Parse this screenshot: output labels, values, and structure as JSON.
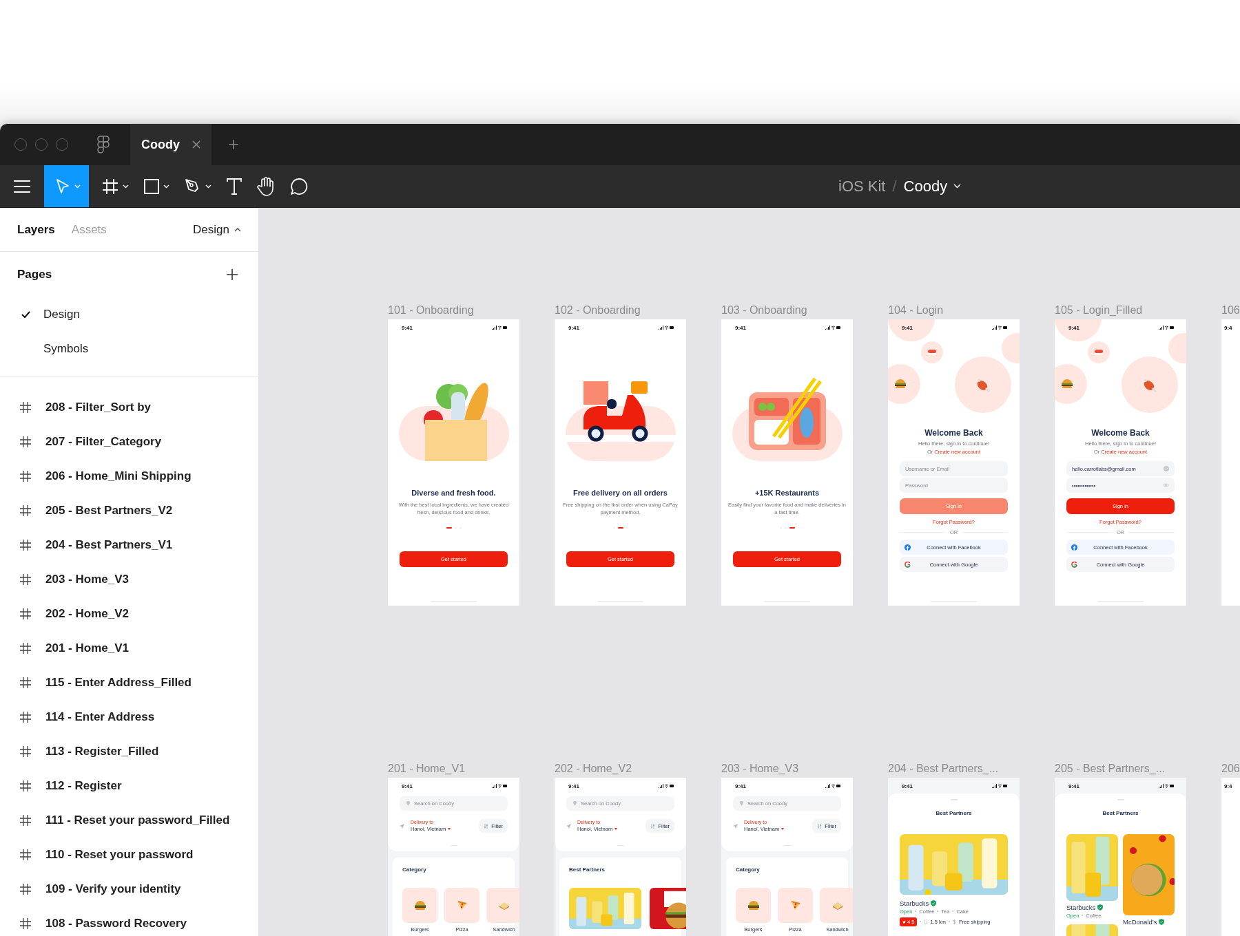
{
  "tabs": [
    {
      "label": "Coody",
      "selected": true
    }
  ],
  "toolbar": {
    "tools": [
      {
        "kind": "move",
        "selected": true
      },
      {
        "kind": "frame",
        "selected": false
      },
      {
        "kind": "shape",
        "selected": false
      },
      {
        "kind": "pen",
        "selected": false
      },
      {
        "kind": "text",
        "selected": false
      },
      {
        "kind": "hand",
        "selected": false
      },
      {
        "kind": "comment",
        "selected": false
      }
    ]
  },
  "breadcrumb": {
    "project": "iOS Kit",
    "separator": "/",
    "file": "Coody"
  },
  "sidebar": {
    "tabs": [
      {
        "label": "Layers",
        "selected": true
      },
      {
        "label": "Assets",
        "selected": false
      }
    ],
    "mode": "Design",
    "pages_title": "Pages",
    "pages": [
      {
        "label": "Design",
        "selected": true
      },
      {
        "label": "Symbols",
        "selected": false
      }
    ],
    "layers": [
      {
        "label": "208 - Filter_Sort by"
      },
      {
        "label": "207 - Filter_Category"
      },
      {
        "label": "206 - Home_Mini Shipping"
      },
      {
        "label": "205 - Best Partners_V2"
      },
      {
        "label": "204 - Best Partners_V1"
      },
      {
        "label": "203 - Home_V3"
      },
      {
        "label": "202 - Home_V2"
      },
      {
        "label": "201 - Home_V1"
      },
      {
        "label": "115 - Enter Address_Filled"
      },
      {
        "label": "114 - Enter Address"
      },
      {
        "label": "113 - Register_Filled"
      },
      {
        "label": "112 - Register"
      },
      {
        "label": "111 - Reset your password_Filled"
      },
      {
        "label": "110 - Reset your password"
      },
      {
        "label": "109 - Verify your identity"
      },
      {
        "label": "108 - Password Recovery"
      }
    ]
  },
  "canvas": {
    "rows": [
      {
        "frames": [
          {
            "kind": "onboarding",
            "label": "101 - Onboarding",
            "time": "9:41",
            "art": {
              "kind": "groceries"
            },
            "title": "Diverse and fresh food.",
            "text": "With the best local ingredients, we have created fresh, delicious food and drinks.",
            "dots": [
              {
                "selected": true
              },
              {
                "selected": false
              },
              {
                "selected": false
              }
            ],
            "button": "Get started"
          },
          {
            "kind": "onboarding",
            "label": "102 - Onboarding",
            "time": "9:41",
            "art": {
              "kind": "scooter"
            },
            "title": "Free delivery on all orders",
            "text": "Free shipping on the first order when using CaPay payment method.",
            "dots": [
              {
                "selected": false
              },
              {
                "selected": true
              },
              {
                "selected": false
              }
            ],
            "button": "Get started"
          },
          {
            "kind": "onboarding",
            "label": "103 - Onboarding",
            "time": "9:41",
            "art": {
              "kind": "lunchbox"
            },
            "title": "+15K Restaurants",
            "text": "Easily find your favorite food and make deliveries in a fast time.",
            "dots": [
              {
                "selected": false
              },
              {
                "selected": false
              },
              {
                "selected": true
              }
            ],
            "button": "Get started"
          },
          {
            "kind": "login",
            "label": "104 - Login",
            "time": "9:41",
            "title": "Welcome Back",
            "subtitle": "Hello there, sign in to continue!",
            "prompt": "Or",
            "link": "Create new account",
            "fields": [
              {
                "placeholder": "Username or Email"
              },
              {
                "placeholder": "Password"
              }
            ],
            "button": {
              "label": "Sign in",
              "disabled": true
            },
            "forgot": "Forgot Password?",
            "divider": "OR",
            "social": [
              {
                "kind": "facebook",
                "label": "Connect with Facebook"
              },
              {
                "kind": "google",
                "label": "Connect with Google"
              }
            ]
          },
          {
            "kind": "login",
            "label": "105 - Login_Filled",
            "time": "9:41",
            "title": "Welcome Back",
            "subtitle": "Hello there, sign in to continue!",
            "prompt": "Or",
            "link": "Create new account",
            "fields": [
              {
                "kind": "email",
                "value": "hello.carrotlabs@gmail.com"
              },
              {
                "kind": "password",
                "value": "•••••••••••••"
              }
            ],
            "button": {
              "label": "Sign in",
              "disabled": false
            },
            "forgot": "Forgot Password?",
            "divider": "OR",
            "social": [
              {
                "kind": "facebook",
                "label": "Connect with Facebook"
              },
              {
                "kind": "google",
                "label": "Connect with Google"
              }
            ]
          },
          {
            "kind": "partial",
            "label": "106",
            "time": "9:4"
          }
        ]
      },
      {
        "frames": [
          {
            "kind": "home",
            "label": "201 - Home_V1",
            "time": "9:41",
            "search": {
              "placeholder": "Search on Coody"
            },
            "delivery_label": "Delivery to",
            "location": "Hanoi, Vietnam",
            "filter": "Filter",
            "section": "Category",
            "categories": [
              {
                "kind": "burger",
                "label": "Burgers"
              },
              {
                "kind": "pizza",
                "label": "Pizza"
              },
              {
                "kind": "sandwich",
                "label": "Sandwich"
              }
            ]
          },
          {
            "kind": "home",
            "label": "202 - Home_V2",
            "time": "9:41",
            "search": {
              "placeholder": "Search on Coody"
            },
            "delivery_label": "Delivery to",
            "location": "Hanoi, Vietnam",
            "filter": "Filter",
            "section": "Best Partners",
            "photos": [
              {
                "kind": "picture"
              },
              {
                "kind": "picture"
              }
            ]
          },
          {
            "kind": "home",
            "label": "203 - Home_V3",
            "time": "9:41",
            "search": {
              "placeholder": "Search on Coody"
            },
            "delivery_label": "Delivery to",
            "location": "Hanoi, Vietnam",
            "filter": "Filter",
            "section": "Category",
            "categories": [
              {
                "kind": "burger",
                "label": "Burgers"
              },
              {
                "kind": "pizza",
                "label": "Pizza"
              },
              {
                "kind": "sandwich",
                "label": "Sandwich"
              }
            ]
          },
          {
            "kind": "partners",
            "label": "204 - Best Partners_...",
            "time": "9:41",
            "title": "Best Partners",
            "cards": [
              {
                "name": "Starbucks",
                "verified": true,
                "status": "Open",
                "tags": [
                  "Coffee",
                  "Tea",
                  "Cake"
                ],
                "rating": "4.5",
                "distance": "1.5 km",
                "shipping": "Free shipping"
              }
            ]
          },
          {
            "kind": "partners_grid",
            "label": "205 - Best Partners_...",
            "time": "9:41",
            "title": "Best Partners",
            "cards": [
              {
                "name": "Starbucks",
                "verified": true,
                "status": "Open",
                "tags": [
                  "Coffee"
                ]
              },
              {
                "name": "McDonald’s",
                "verified": true
              },
              {
                "kind": "picture"
              }
            ]
          },
          {
            "kind": "partial",
            "label": "206",
            "time": "9:4"
          }
        ]
      }
    ]
  }
}
